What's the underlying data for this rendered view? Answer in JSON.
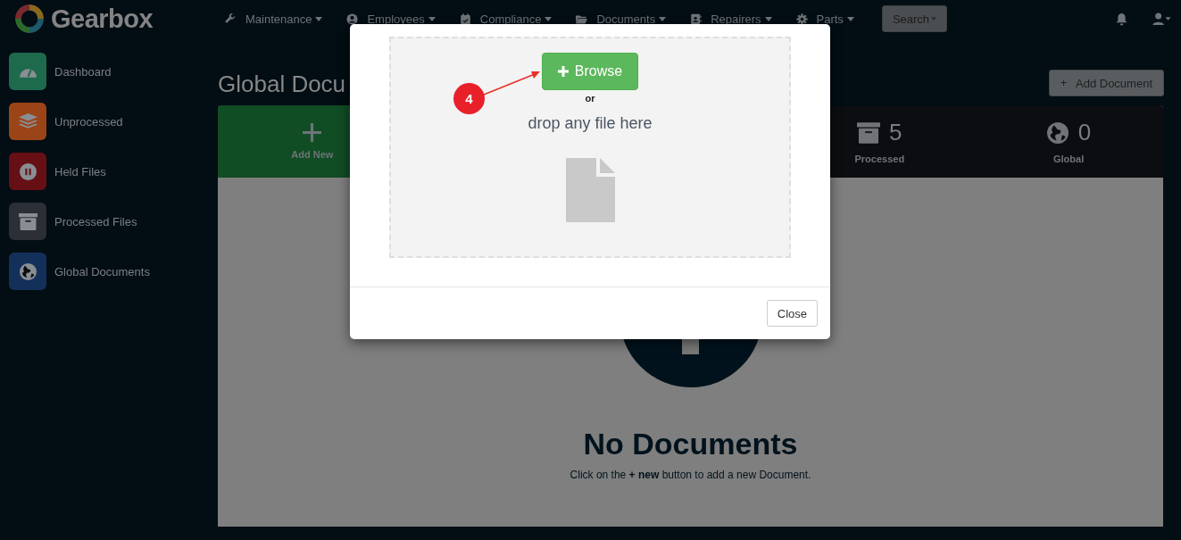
{
  "app": {
    "name": "Gearbox"
  },
  "nav": [
    {
      "label": "Maintenance"
    },
    {
      "label": "Employees"
    },
    {
      "label": "Compliance"
    },
    {
      "label": "Documents"
    },
    {
      "label": "Repairers"
    },
    {
      "label": "Parts"
    }
  ],
  "search_button": "Search",
  "sidebar": {
    "items": [
      {
        "label": "Dashboard",
        "color": "#1e6a4c"
      },
      {
        "label": "Unprocessed",
        "color": "#9a4418"
      },
      {
        "label": "Held Files",
        "color": "#661015"
      },
      {
        "label": "Processed Files",
        "color": "#2c2f36"
      },
      {
        "label": "Global Documents",
        "color": "#13305a"
      }
    ]
  },
  "page": {
    "title": "Global Docu",
    "add_button_icon": "+",
    "add_button": "Add Document"
  },
  "stats": [
    {
      "kind": "add",
      "label": "Add New"
    },
    {
      "kind": "hidden"
    },
    {
      "kind": "hidden"
    },
    {
      "kind": "count",
      "count": "5",
      "label": "Processed"
    },
    {
      "kind": "count",
      "count": "0",
      "label": "Global"
    }
  ],
  "empty_state": {
    "title": "No Documents",
    "message": "Click on the **+ new** button to add a new Document."
  },
  "modal": {
    "browse_button": "Browse",
    "or": "or",
    "drop_text": "drop any file here",
    "close_button": "Close"
  },
  "annotation": {
    "label": "4"
  }
}
